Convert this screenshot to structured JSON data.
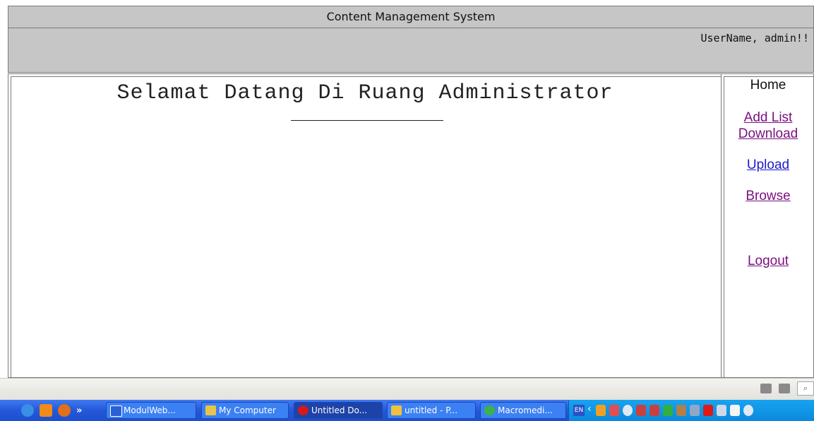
{
  "app": {
    "title": "Content Management System",
    "user_label": "UserName, admin!!"
  },
  "main": {
    "welcome": "Selamat Datang Di Ruang Administrator"
  },
  "sidebar": {
    "items": [
      {
        "label": "Home"
      },
      {
        "label": "Add List Download"
      },
      {
        "label": "Upload"
      },
      {
        "label": "Browse"
      },
      {
        "label": "Logout"
      }
    ]
  },
  "taskbar": {
    "buttons": [
      {
        "label": "ModulWeb...",
        "icon": "word-icon",
        "color": "#2b5fd6"
      },
      {
        "label": "My Computer",
        "icon": "folder-icon",
        "color": "#e8c44a"
      },
      {
        "label": "Untitled Do...",
        "icon": "opera-icon",
        "color": "#d21a1a",
        "active": true
      },
      {
        "label": "untitled - P...",
        "icon": "paint-icon",
        "color": "#f0c040"
      },
      {
        "label": "Macromedi...",
        "icon": "dreamweaver-icon",
        "color": "#3bb24a"
      }
    ],
    "lang": "EN"
  },
  "colors": {
    "header_bg": "#c6c6c6",
    "link_visited": "#7b1080",
    "link": "#1a1acc",
    "taskbar": "#2458d8"
  }
}
